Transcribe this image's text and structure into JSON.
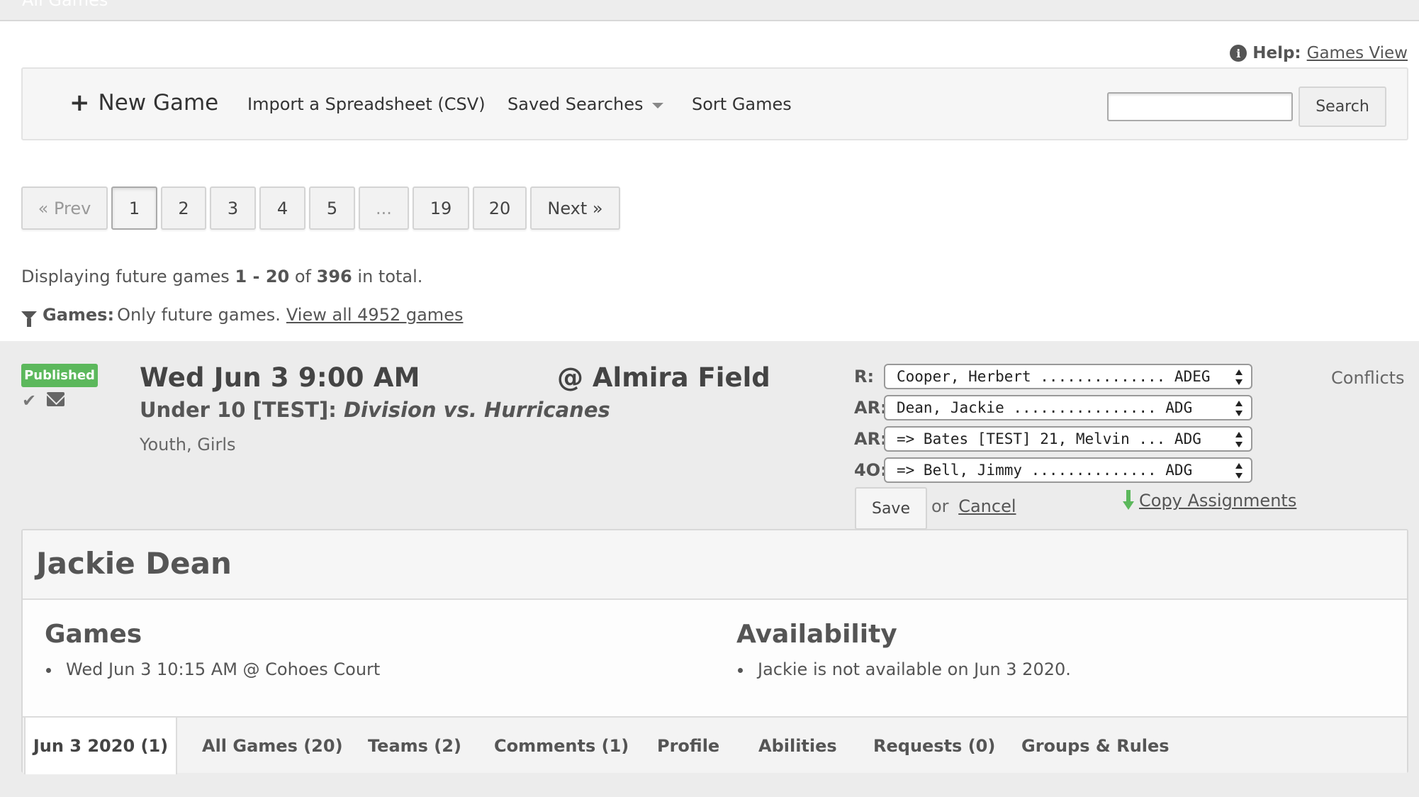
{
  "page": {
    "title": "All Games"
  },
  "help": {
    "label": "Help:",
    "link": "Games View"
  },
  "toolbar": {
    "new_game": "New Game",
    "import": "Import a Spreadsheet (CSV)",
    "saved_searches": "Saved Searches",
    "sort": "Sort Games",
    "search_value": "",
    "search_button": "Search"
  },
  "pagination": {
    "prev": "« Prev",
    "pages": [
      "1",
      "2",
      "3",
      "4",
      "5",
      "...",
      "19",
      "20"
    ],
    "current": "1",
    "next": "Next »"
  },
  "summary": {
    "prefix": "Displaying future games",
    "range": "1 - 20",
    "of": "of",
    "total": "396",
    "suffix": "in total."
  },
  "filter": {
    "label": "Games:",
    "text": "Only future games.",
    "link": "View all 4952 games"
  },
  "game": {
    "status": "Published",
    "time": "Wed Jun 3 9:00 AM",
    "division": "Under 10 [TEST]:",
    "matchup": "Division vs. Hurricanes",
    "tags": "Youth, Girls",
    "location": "@ Almira Field",
    "conflicts": "Conflicts",
    "assignments": [
      {
        "role": "R:",
        "value": "Cooper, Herbert .............. ADEG"
      },
      {
        "role": "AR:",
        "value": "Dean, Jackie ................ ADG"
      },
      {
        "role": "AR:",
        "value": "=> Bates [TEST] 21, Melvin ... ADG"
      },
      {
        "role": "4O:",
        "value": "=> Bell, Jimmy .............. ADG"
      }
    ],
    "save": "Save",
    "or": "or",
    "cancel": "Cancel",
    "copy": "Copy Assignments"
  },
  "official": {
    "name": "Jackie Dean",
    "games_title": "Games",
    "games": [
      "Wed Jun 3 10:15 AM @ Cohoes Court"
    ],
    "availability_title": "Availability",
    "availability": [
      "Jackie is not available on Jun 3 2020."
    ],
    "tabs": [
      "Jun 3 2020 (1)",
      "All Games (20)",
      "Teams (2)",
      "Comments (1)",
      "Profile",
      "Abilities",
      "Requests (0)",
      "Groups & Rules"
    ]
  }
}
